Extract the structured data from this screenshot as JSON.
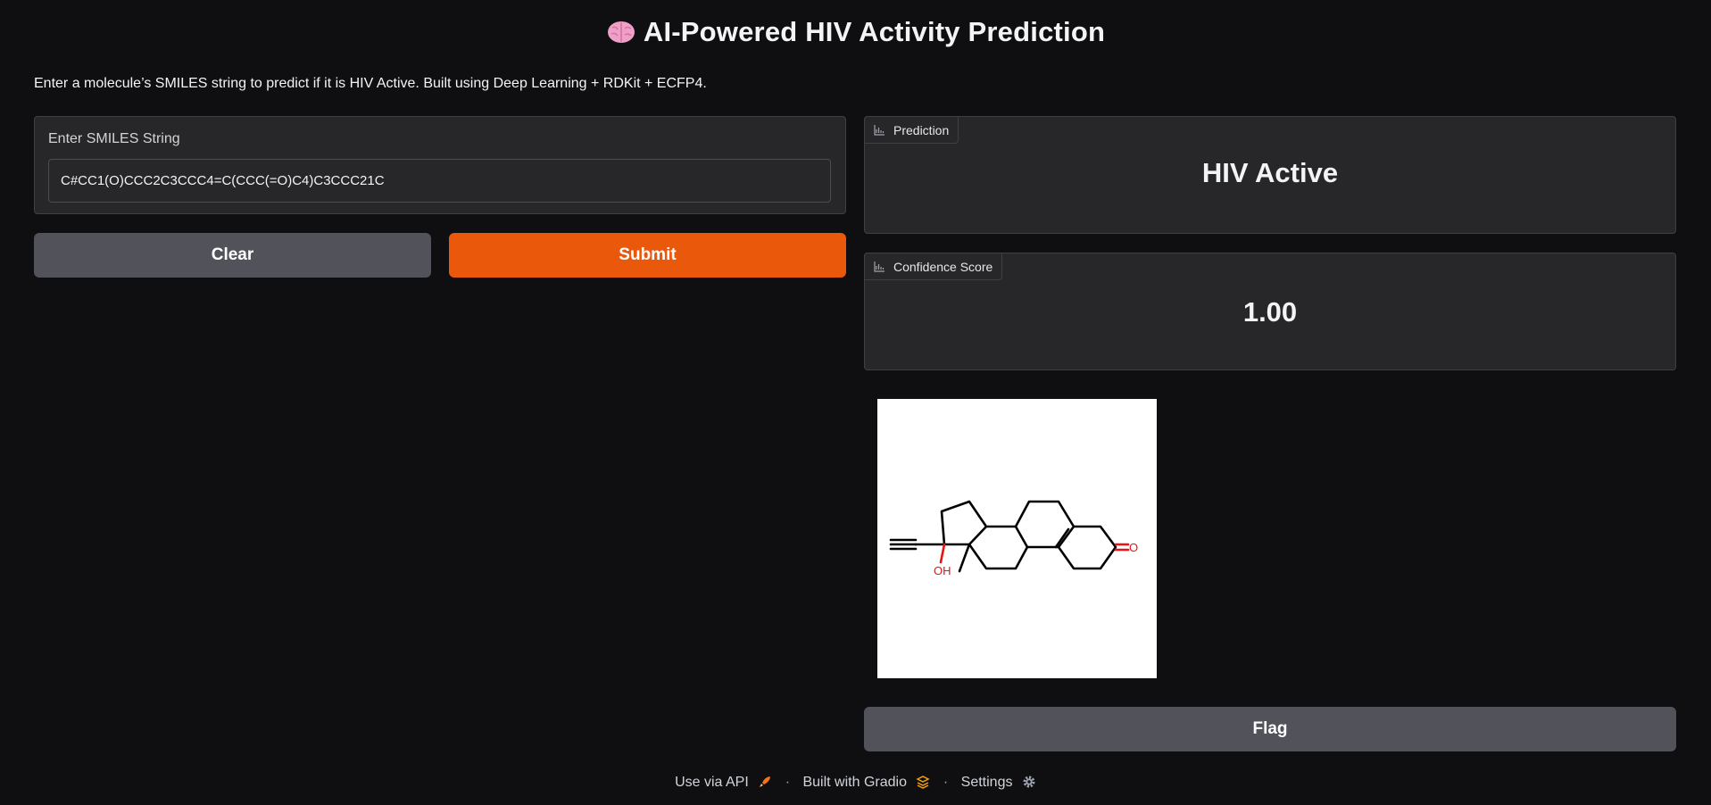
{
  "header": {
    "title": "AI-Powered HIV Activity Prediction",
    "title_icon": "brain-icon",
    "description": "Enter a molecule’s SMILES string to predict if it is HIV Active. Built using Deep Learning + RDKit + ECFP4."
  },
  "input": {
    "label": "Enter SMILES String",
    "value": "C#CC1(O)CCC2C3CCC4=C(CCC(=O)C4)C3CCC21C"
  },
  "buttons": {
    "clear": "Clear",
    "submit": "Submit",
    "flag": "Flag"
  },
  "outputs": {
    "prediction_label": "Prediction",
    "prediction_value": "HIV Active",
    "confidence_label": "Confidence Score",
    "confidence_value": "1.00",
    "label_icon": "bar-chart-icon"
  },
  "molecule": {
    "oh_label": "OH",
    "o_label": "O"
  },
  "footer": {
    "api": "Use via API",
    "gradio": "Built with Gradio",
    "settings": "Settings",
    "api_icon": "rocket-icon",
    "gradio_icon": "gradio-logo-icon",
    "settings_icon": "gear-icon"
  },
  "colors": {
    "background": "#0f0f11",
    "panel": "#27272a",
    "accent": "#ea580c",
    "secondary_button": "#52525b"
  }
}
